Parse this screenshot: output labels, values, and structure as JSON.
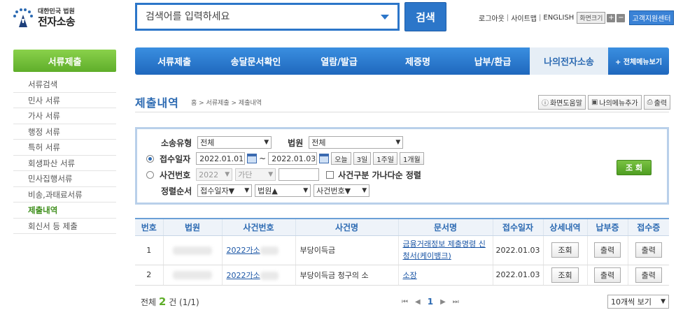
{
  "logo": {
    "sub": "대한민국 법원",
    "main": "전자소송"
  },
  "search": {
    "placeholder": "검색어를 입력하세요",
    "button": "검색"
  },
  "util": {
    "logout": "로그아웃",
    "sitemap": "사이트맵",
    "english": "ENGLISH",
    "font_size": "화면크기",
    "plus": "+",
    "minus": "−",
    "customer_center": "고객지원센터"
  },
  "sidebar": {
    "title": "서류제출",
    "items": [
      "서류검색",
      "민사 서류",
      "가사 서류",
      "행정 서류",
      "특허 서류",
      "회생파산 서류",
      "민사집행서류",
      "비송,과태료서류",
      "제출내역",
      "회신서 등 제출"
    ],
    "active_index": 8
  },
  "nav": {
    "items": [
      "서류제출",
      "송달문서확인",
      "열람/발급",
      "제증명",
      "납부/환급",
      "나의전자소송"
    ],
    "all_menu": "+ 전체메뉴보기"
  },
  "page": {
    "title": "제출내역",
    "breadcrumb": "홈 > 서류제출 > 제출내역",
    "help": "화면도움말",
    "add_menu": "나의메뉴추가",
    "print": "출력"
  },
  "filter": {
    "case_type_label": "소송유형",
    "case_type_value": "전체",
    "court_label": "법원",
    "court_value": "전체",
    "receipt_date_label": "접수일자",
    "date_from": "2022.01.01",
    "tilde": "~",
    "date_to": "2022.01.03",
    "periods": [
      "오늘",
      "3일",
      "1주일",
      "1개월"
    ],
    "case_no_label": "사건번호",
    "case_year": "2022",
    "case_kind": "가단",
    "sort_check_label": "사건구분 가나다순 정렬",
    "order_label": "정렬순서",
    "order1": "접수일자▼",
    "order2": "법원▲",
    "order3": "사건번호▼",
    "query_button": "조 회"
  },
  "table": {
    "headers": [
      "번호",
      "법원",
      "사건번호",
      "사건명",
      "문서명",
      "접수일자",
      "상세내역",
      "납부증",
      "접수증"
    ],
    "rows": [
      {
        "no": "1",
        "case_no": "2022가소",
        "case_name": "부당이득금",
        "doc_name": "금융거래정보 제출명령 신청서(케이뱅크)",
        "date": "2022.01.03",
        "detail": "조회",
        "payment": "출력",
        "receipt": "출력"
      },
      {
        "no": "2",
        "case_no": "2022가소",
        "case_name": "부당이득금 청구의 소",
        "doc_name": "소장",
        "date": "2022.01.03",
        "detail": "조회",
        "payment": "출력",
        "receipt": "출력"
      }
    ]
  },
  "footer": {
    "total_prefix": "전체",
    "total_count": "2",
    "total_suffix": "건 (1/1)",
    "first": "⏮",
    "prev": "◀",
    "current_page": "1",
    "next": "▶",
    "last": "⏭",
    "per_page": "10개씩 보기"
  },
  "colors": {
    "primary_blue": "#2c76c9",
    "sidebar_green": "#6cbf35",
    "link_blue": "#1a55a5"
  }
}
